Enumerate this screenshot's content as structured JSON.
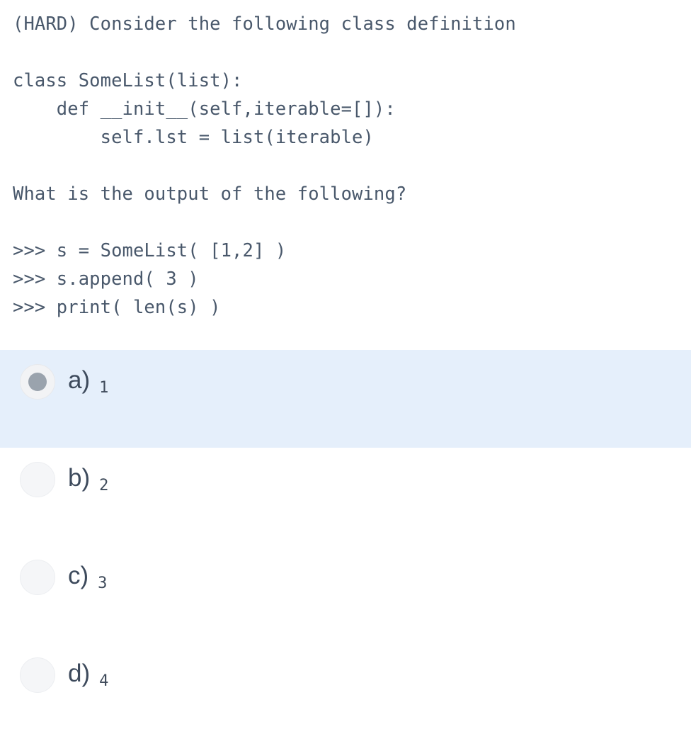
{
  "question": {
    "lines": [
      "(HARD) Consider the following class definition",
      "",
      "class SomeList(list):",
      "    def __init__(self,iterable=[]):",
      "        self.lst = list(iterable)",
      "",
      "What is the output of the following?",
      "",
      ">>> s = SomeList( [1,2] )",
      ">>> s.append( 3 )",
      ">>> print( len(s) )"
    ]
  },
  "options": [
    {
      "letter": "a)",
      "value": "1",
      "selected": true
    },
    {
      "letter": "b)",
      "value": "2",
      "selected": false
    },
    {
      "letter": "c)",
      "value": "3",
      "selected": false
    },
    {
      "letter": "d)",
      "value": "4",
      "selected": false
    }
  ],
  "colors": {
    "text": "#49586b",
    "selected_row_background": "#e5effb",
    "radio_background": "#f5f6f8",
    "radio_dot": "#9aa3ad"
  }
}
